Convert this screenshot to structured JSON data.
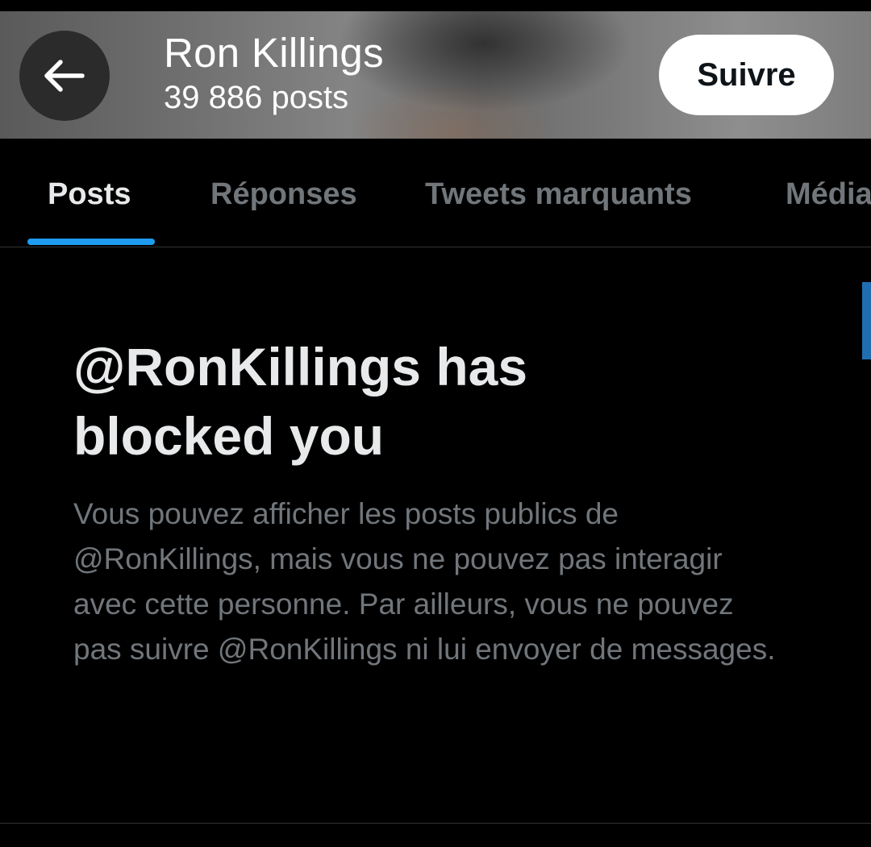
{
  "header": {
    "back_icon": "arrow-left-icon",
    "name": "Ron Killings",
    "posts_count": "39 886 posts",
    "follow_label": "Suivre"
  },
  "tabs": [
    {
      "label": "Posts",
      "active": true
    },
    {
      "label": "Réponses",
      "active": false
    },
    {
      "label": "Tweets marquants",
      "active": false
    },
    {
      "label": "Média",
      "active": false
    }
  ],
  "blocked": {
    "title": "@RonKillings has blocked you",
    "description": "Vous pouvez afficher les posts publics de @RonKillings, mais vous ne pouvez pas interagir avec cette personne. Par ailleurs, vous ne pouvez pas suivre @RonKillings ni lui envoyer de messages."
  },
  "colors": {
    "accent": "#1d9bf0",
    "background": "#000000",
    "primary_text": "#e7e9ea",
    "secondary_text": "#71767b"
  }
}
